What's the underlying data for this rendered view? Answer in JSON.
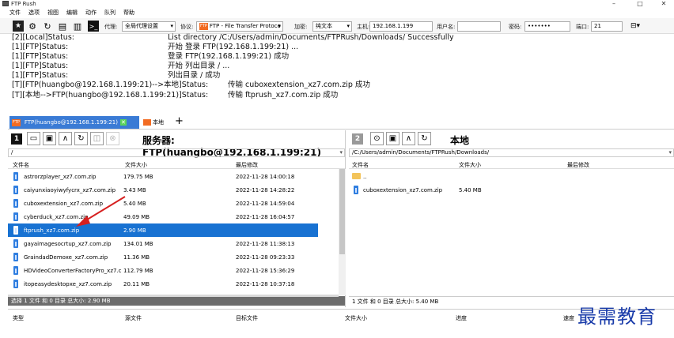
{
  "window": {
    "title": "FTP Rush",
    "minimize": "–",
    "maximize": "□",
    "close": "✕"
  },
  "menu": [
    "文件",
    "选项",
    "视图",
    "编辑",
    "动作",
    "队列",
    "帮助"
  ],
  "toolbar": {
    "proxy_label": "代理:",
    "proxy_value": "全局代理设置",
    "protocol_label": "协议:",
    "protocol_value": "FTP - File Transfer Protoco",
    "encrypt_label": "加密:",
    "encrypt_value": "纯文本",
    "host_label": "主机:",
    "host_value": "192.168.1.199",
    "user_label": "用户名:",
    "user_value": "",
    "password_label": "密码:",
    "password_value": "•••••••",
    "port_label": "端口:",
    "port_value": "21"
  },
  "log": [
    {
      "a": "[2][Local]Status:",
      "b": "List directory /C:/Users/admin/Documents/FTPRush/Downloads/ Successfully"
    },
    {
      "a": "[1][FTP]Status:",
      "b": "开始 登录 FTP(192.168.1.199:21) ..."
    },
    {
      "a": "[1][FTP]Status:",
      "b": "登录 FTP(192.168.1.199:21) 成功"
    },
    {
      "a": "[1][FTP]Status:",
      "b": "开始 列出目录 / ..."
    },
    {
      "a": "[1][FTP]Status:",
      "b": "列出目录 / 成功"
    },
    {
      "a": "[T][FTP(huangbo@192.168.1.199:21)-->本地]Status:",
      "b": "传输 cuboxextension_xz7.com.zip 成功"
    },
    {
      "a": "[T][本地-->FTP(huangbo@192.168.1.199:21)]Status:",
      "b": "传输 ftprush_xz7.com.zip 成功"
    }
  ],
  "tabs": {
    "tab1": "FTP(huangbo@192.168.1.199:21)",
    "tab2": "本地",
    "add": "+"
  },
  "left": {
    "num": "1",
    "title": "服务器: FTP(huangbo@192.168.1.199:21)",
    "path": "/",
    "headers": {
      "name": "文件名",
      "size": "文件大小",
      "modified": "最后修改"
    },
    "files": [
      {
        "name": "astrorzplayer_xz7.com.zip",
        "size": "179.75 MB",
        "modified": "2022-11-28 14:00:18"
      },
      {
        "name": "caiyunxiaoyiwyfycrx_xz7.com.zip",
        "size": "3.43 MB",
        "modified": "2022-11-28 14:28:22"
      },
      {
        "name": "cuboxextension_xz7.com.zip",
        "size": "5.40 MB",
        "modified": "2022-11-28 14:59:04"
      },
      {
        "name": "cyberduck_xz7.com.zip",
        "size": "49.09 MB",
        "modified": "2022-11-28 16:04:57"
      },
      {
        "name": "ftprush_xz7.com.zip",
        "size": "2.90 MB",
        "modified": ""
      },
      {
        "name": "gayaimagesocrtup_xz7.com.zip",
        "size": "134.01 MB",
        "modified": "2022-11-28 11:38:13"
      },
      {
        "name": "GraindadDemoxe_xz7.com.zip",
        "size": "11.36 MB",
        "modified": "2022-11-28 09:23:33"
      },
      {
        "name": "HDVideoConverterFactoryPro_xz7.c",
        "size": "112.79 MB",
        "modified": "2022-11-28 15:36:29"
      },
      {
        "name": "itopeasydesktopxe_xz7.com.zip",
        "size": "20.11 MB",
        "modified": "2022-11-28 10:37:18"
      }
    ],
    "status": "选择 1 文件 和 0 目录 总大小: 2.90 MB"
  },
  "right": {
    "num": "2",
    "title": "本地",
    "path": "/C:/Users/admin/Documents/FTPRush/Downloads/",
    "headers": {
      "name": "文件名",
      "size": "文件大小",
      "modified": "最后修改"
    },
    "parent": "..",
    "files": [
      {
        "name": "cuboxextension_xz7.com.zip",
        "size": "5.40 MB",
        "modified": ""
      }
    ],
    "status": "1 文件 和 0 目录 总大小: 5.40 MB"
  },
  "queue_headers": [
    "类型",
    "源文件",
    "目标文件",
    "文件大小",
    "进度",
    "速度"
  ],
  "watermark": "最需教育",
  "colors": {
    "selection": "#1872d2",
    "tab_active": "#3a7bd5",
    "ftp_badge": "#f26b22",
    "arrow": "#d62020"
  }
}
